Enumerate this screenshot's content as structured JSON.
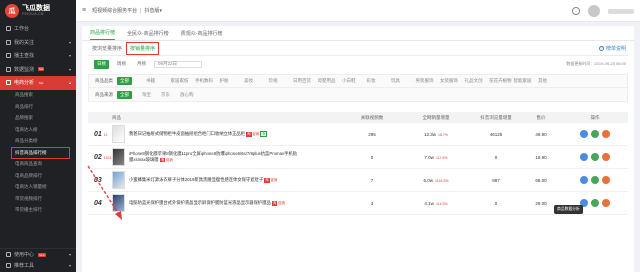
{
  "brand": {
    "name": "飞瓜数据",
    "sub": "FEIGUA.CN",
    "mark": "瓜"
  },
  "sidebar": {
    "items": [
      {
        "label": "工作台",
        "icon": "home-icon"
      },
      {
        "label": "我的关注",
        "icon": "heart-icon"
      },
      {
        "label": "播主查找",
        "icon": "search-icon"
      },
      {
        "label": "数据监测",
        "icon": "monitor-icon",
        "hot": "hot"
      },
      {
        "label": "电商分析",
        "icon": "cart-icon",
        "hot": "hot"
      }
    ],
    "sub_items": [
      "商品搜索",
      "商品排行",
      "品牌搜索",
      "电商达人榜",
      "商品分类榜",
      "抖音商品排行榜",
      "电商商品查询",
      "电商品牌排行",
      "电商达人销量榜",
      "带货视频排行",
      "带货播主排行"
    ],
    "bottom": [
      {
        "label": "使用中心",
        "icon": "help-icon",
        "hot": "new"
      },
      {
        "label": "推荐工具",
        "icon": "tool-icon"
      }
    ]
  },
  "topbar": {
    "menu_glyph": "≡",
    "crumbs": [
      "短视频综合服务平台",
      "抖音版"
    ]
  },
  "tabs": [
    "商品排行榜",
    "全民众-商品排行榜",
    "费观众-商品排行榜"
  ],
  "rank": {
    "label": "按浏览量排序",
    "type": "按销量排序",
    "intro": "榜单说明",
    "intro_glyph": "?"
  },
  "period": {
    "options": [
      "日榜",
      "周榜",
      "月榜"
    ],
    "date": "09月22日",
    "update": "数据更新时间：2019-09-23 06:00"
  },
  "filters": [
    {
      "label": "商品品类",
      "options": [
        "全部",
        "书籍",
        "家居家纺",
        "手机数码",
        "护肤",
        "美妆",
        "珍视",
        "日用百货",
        "母婴用品",
        "小白鞋",
        "彩妆",
        "玩具",
        "男装服饰",
        "女装服饰",
        "礼品文创",
        "花花卉植物",
        "智能家居",
        "其他"
      ]
    },
    {
      "label": "商品来源",
      "options": [
        "全部",
        "淘宝",
        "京东",
        "放心购"
      ]
    }
  ],
  "table": {
    "headers": [
      "商品",
      "关联视频数",
      "全网销量增量",
      "抖音浏览量增量",
      "售价",
      "操作"
    ],
    "rows": [
      {
        "rank": "01",
        "sub": "11",
        "name": "我爸日记抽屉式储物柜牛皮面抽屉组合柜门口收纳立体正品柜",
        "cx": "促销",
        "vid": "295",
        "sales": "12.3w",
        "pct": "18.7%",
        "views": "46125",
        "price": "49.90",
        "thumb": "a"
      },
      {
        "rank": "02",
        "sub": "11023",
        "name": "iPhone8钢化膜苹果8钢化膜11pro全屏iphone8防爆iphone6/6s/7/8plus抗蓝Promax手机贴膜xsmax玻璃膜",
        "cx": "促销",
        "vid": "0",
        "sales": "7.0w",
        "pct": "117.6%",
        "views": "0",
        "price": "19.90",
        "thumb": "b"
      },
      {
        "rank": "03",
        "sub": "",
        "name": "小蜜蜂集米灯源泳衣裤子分体2019新款黑腰显瘦性感连体女保守遮肚子",
        "cx": "促销",
        "vid": "7",
        "sales": "6.0w",
        "pct": "1144.5%",
        "views": "887",
        "price": "68.00",
        "thumb": "c"
      },
      {
        "rank": "04",
        "sub": "",
        "name": "电脑防蓝光保护膜台式外保护液晶显示屏保护膜防蓝光液晶显示器保护膜品",
        "cx": "促销",
        "vid": "3",
        "sales": "4.1w",
        "pct": "114.3%",
        "views": "0",
        "price": "29.00",
        "thumb": "d"
      }
    ],
    "tooltip": "商品数据分析"
  },
  "colors": {
    "accent": "#2ea043",
    "sidebar": "#1f2124",
    "danger": "#e03a3a"
  }
}
